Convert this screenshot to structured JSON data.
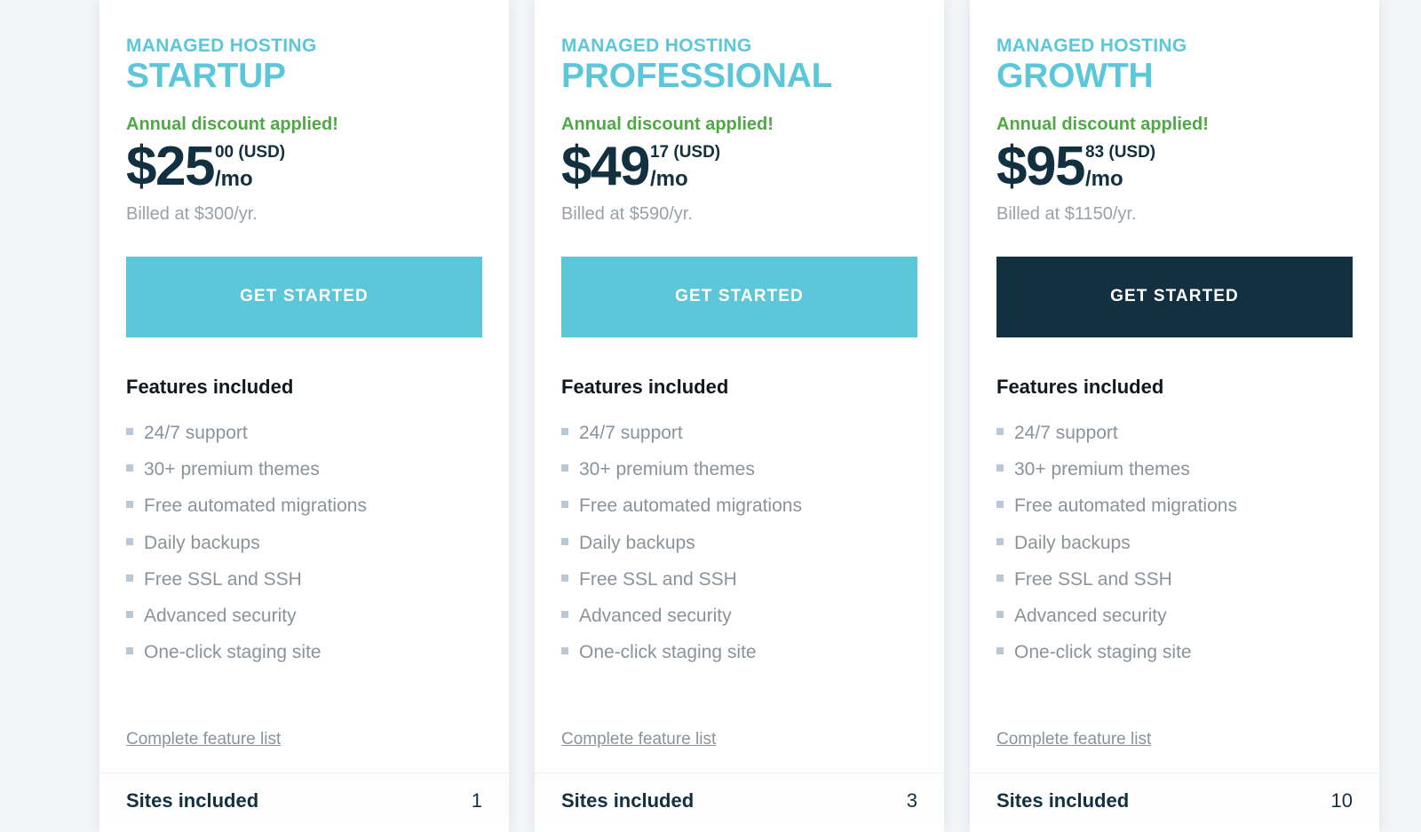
{
  "page": {
    "background_color": "#f3f5f9",
    "accent_teal": "#5bc7d8",
    "accent_green": "#4fa845",
    "accent_dark": "#12303f"
  },
  "plans": [
    {
      "eyebrow": "MANAGED HOSTING",
      "name": "STARTUP",
      "discount_note": "Annual discount applied!",
      "price_main": "$25",
      "price_cents": "00 (USD)",
      "price_period": "/mo",
      "billed_note": "Billed at $300/yr.",
      "cta_label": "GET STARTED",
      "cta_style": "teal",
      "features_title": "Features included",
      "features": [
        "24/7 support",
        "30+ premium themes",
        "Free automated migrations",
        "Daily backups",
        "Free SSL and SSH",
        "Advanced security",
        "One-click staging site"
      ],
      "feature_link": "Complete feature list",
      "sites_label": "Sites included",
      "sites_value": "1"
    },
    {
      "eyebrow": "MANAGED HOSTING",
      "name": "PROFESSIONAL",
      "discount_note": "Annual discount applied!",
      "price_main": "$49",
      "price_cents": "17 (USD)",
      "price_period": "/mo",
      "billed_note": "Billed at $590/yr.",
      "cta_label": "GET STARTED",
      "cta_style": "teal",
      "features_title": "Features included",
      "features": [
        "24/7 support",
        "30+ premium themes",
        "Free automated migrations",
        "Daily backups",
        "Free SSL and SSH",
        "Advanced security",
        "One-click staging site"
      ],
      "feature_link": "Complete feature list",
      "sites_label": "Sites included",
      "sites_value": "3"
    },
    {
      "eyebrow": "MANAGED HOSTING",
      "name": "GROWTH",
      "discount_note": "Annual discount applied!",
      "price_main": "$95",
      "price_cents": "83 (USD)",
      "price_period": "/mo",
      "billed_note": "Billed at $1150/yr.",
      "cta_label": "GET STARTED",
      "cta_style": "dark",
      "features_title": "Features included",
      "features": [
        "24/7 support",
        "30+ premium themes",
        "Free automated migrations",
        "Daily backups",
        "Free SSL and SSH",
        "Advanced security",
        "One-click staging site"
      ],
      "feature_link": "Complete feature list",
      "sites_label": "Sites included",
      "sites_value": "10"
    }
  ]
}
